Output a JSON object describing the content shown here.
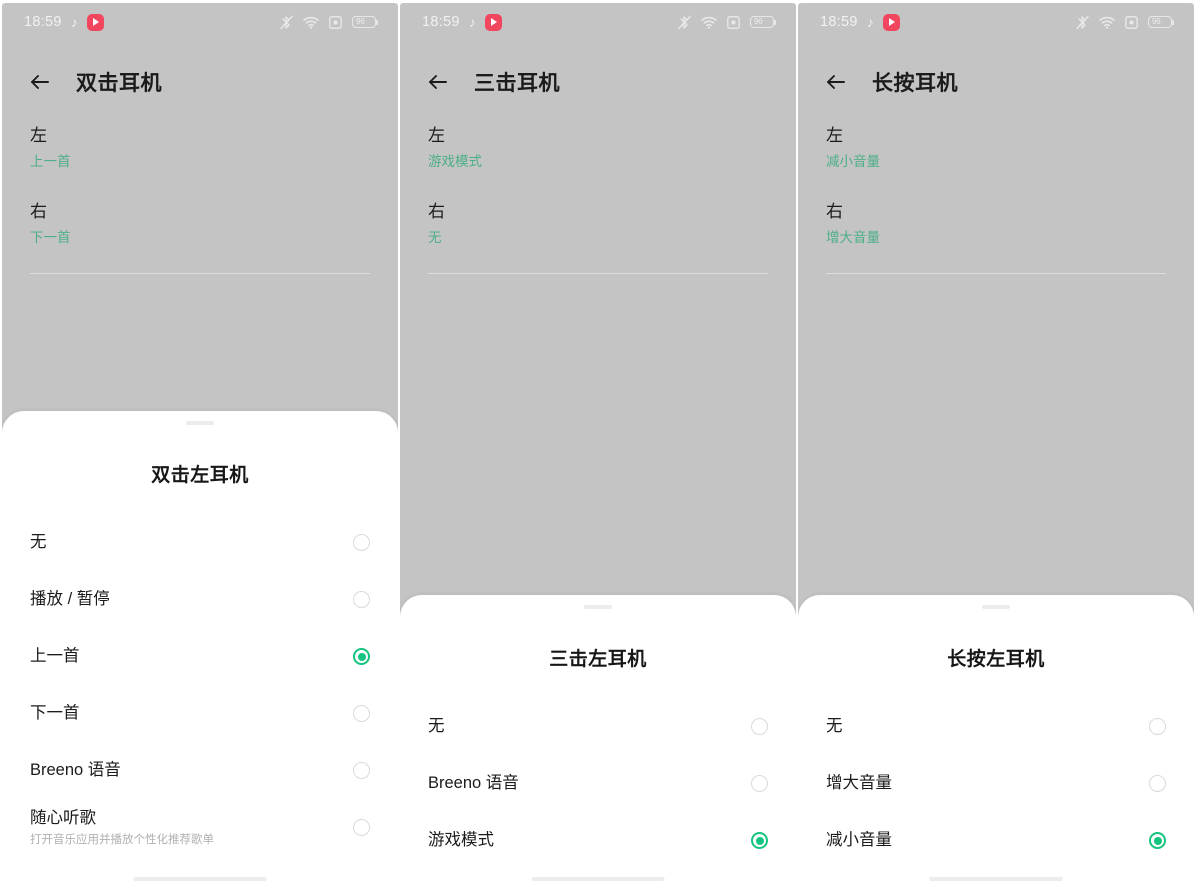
{
  "status_bar": {
    "time": "18:59",
    "battery_level": "96",
    "icons": [
      "music-note-icon",
      "media-app-icon",
      "bluetooth-muted-icon",
      "wifi-icon",
      "dnd-icon",
      "battery-icon"
    ]
  },
  "panels": [
    {
      "header_title": "双击耳机",
      "back_icon": "back-arrow-icon",
      "sides": [
        {
          "name": "左",
          "value": "上一首"
        },
        {
          "name": "右",
          "value": "下一首"
        }
      ],
      "sheet": {
        "title": "双击左耳机",
        "options": [
          {
            "label": "无",
            "sub": "",
            "selected": false
          },
          {
            "label": "播放 / 暂停",
            "sub": "",
            "selected": false
          },
          {
            "label": "上一首",
            "sub": "",
            "selected": true
          },
          {
            "label": "下一首",
            "sub": "",
            "selected": false
          },
          {
            "label": "Breeno 语音",
            "sub": "",
            "selected": false
          },
          {
            "label": "随心听歌",
            "sub": "打开音乐应用并播放个性化推荐歌单",
            "selected": false
          }
        ]
      }
    },
    {
      "header_title": "三击耳机",
      "back_icon": "back-arrow-icon",
      "sides": [
        {
          "name": "左",
          "value": "游戏模式"
        },
        {
          "name": "右",
          "value": "无"
        }
      ],
      "sheet": {
        "title": "三击左耳机",
        "options": [
          {
            "label": "无",
            "sub": "",
            "selected": false
          },
          {
            "label": "Breeno 语音",
            "sub": "",
            "selected": false
          },
          {
            "label": "游戏模式",
            "sub": "",
            "selected": true
          }
        ]
      }
    },
    {
      "header_title": "长按耳机",
      "back_icon": "back-arrow-icon",
      "sides": [
        {
          "name": "左",
          "value": "减小音量"
        },
        {
          "name": "右",
          "value": "增大音量"
        }
      ],
      "sheet": {
        "title": "长按左耳机",
        "options": [
          {
            "label": "无",
            "sub": "",
            "selected": false
          },
          {
            "label": "增大音量",
            "sub": "",
            "selected": false
          },
          {
            "label": "减小音量",
            "sub": "",
            "selected": true
          }
        ]
      }
    }
  ],
  "colors": {
    "panel_background": "#c4c4c4",
    "accent_green": "#15c47e",
    "value_green": "#4caf87",
    "sheet_background": "#ffffff",
    "app_icon_red": "#f2455e"
  }
}
